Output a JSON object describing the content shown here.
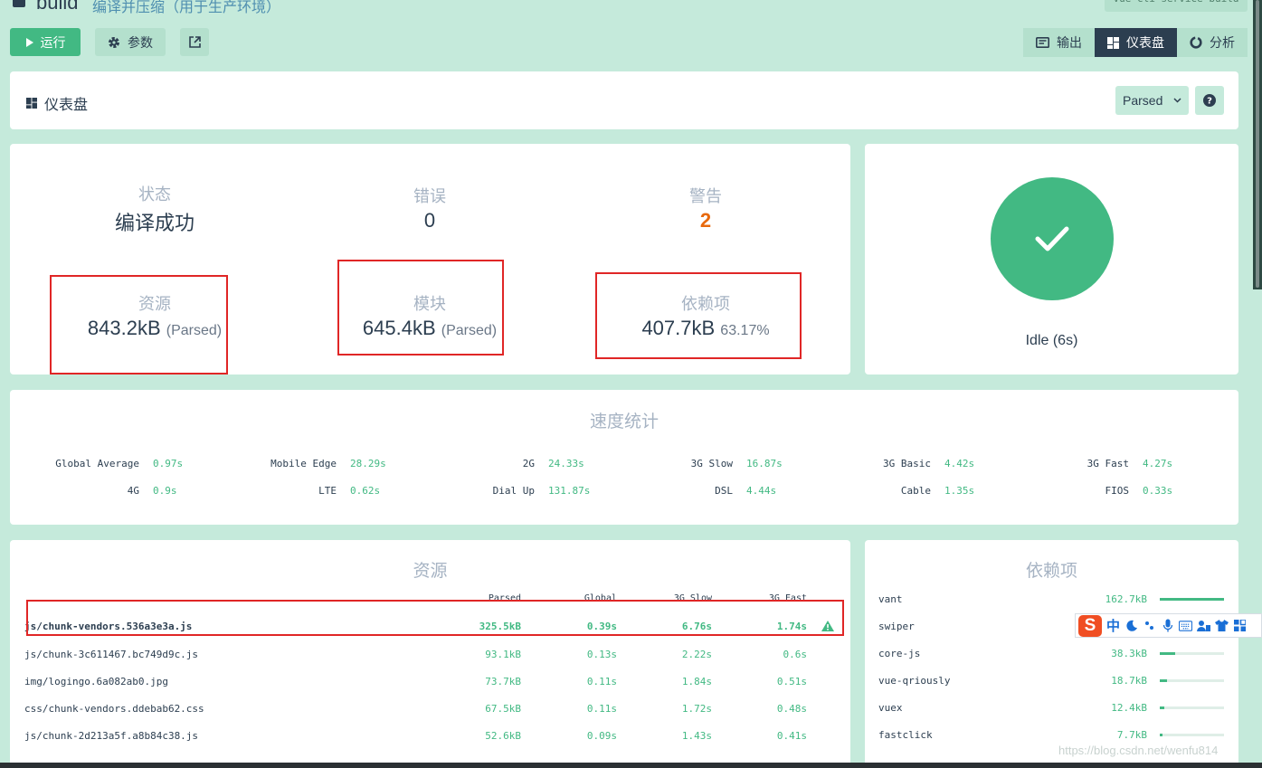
{
  "project": {
    "name": "build",
    "description": "编译并压缩（用于生产环境）",
    "command": "vue-cli-service build"
  },
  "toolbar": {
    "run_label": "运行",
    "params_label": "参数"
  },
  "view_tabs": [
    {
      "label": "输出",
      "active": false
    },
    {
      "label": "仪表盘",
      "active": true
    },
    {
      "label": "分析",
      "active": false
    }
  ],
  "dashboard": {
    "title": "仪表盘",
    "mode": "Parsed"
  },
  "stats": {
    "status": {
      "label": "状态",
      "value": "编译成功"
    },
    "errors": {
      "label": "错误",
      "value": "0"
    },
    "warnings": {
      "label": "警告",
      "value": "2"
    },
    "assets": {
      "label": "资源",
      "value": "843.2kB",
      "note": "(Parsed)"
    },
    "modules": {
      "label": "模块",
      "value": "645.4kB",
      "note": "(Parsed)"
    },
    "dependencies": {
      "label": "依赖项",
      "value": "407.7kB",
      "note": "63.17%"
    }
  },
  "build_status": {
    "text": "Idle (6s)"
  },
  "speed": {
    "title": "速度统计",
    "items": [
      {
        "label": "Global Average",
        "value": "0.97s"
      },
      {
        "label": "Mobile Edge",
        "value": "28.29s"
      },
      {
        "label": "2G",
        "value": "24.33s"
      },
      {
        "label": "3G Slow",
        "value": "16.87s"
      },
      {
        "label": "3G Basic",
        "value": "4.42s"
      },
      {
        "label": "3G Fast",
        "value": "4.27s"
      },
      {
        "label": "4G",
        "value": "0.9s"
      },
      {
        "label": "LTE",
        "value": "0.62s"
      },
      {
        "label": "Dial Up",
        "value": "131.87s"
      },
      {
        "label": "DSL",
        "value": "4.44s"
      },
      {
        "label": "Cable",
        "value": "1.35s"
      },
      {
        "label": "FIOS",
        "value": "0.33s"
      }
    ]
  },
  "assets": {
    "title": "资源",
    "columns": [
      "Parsed",
      "Global",
      "3G Slow",
      "3G Fast"
    ],
    "rows": [
      {
        "name": "js/chunk-vendors.536a3e3a.js",
        "parsed": "325.5kB",
        "global": "0.39s",
        "slow": "6.76s",
        "fast": "1.74s",
        "warning": true
      },
      {
        "name": "js/chunk-3c611467.bc749d9c.js",
        "parsed": "93.1kB",
        "global": "0.13s",
        "slow": "2.22s",
        "fast": "0.6s",
        "warning": false
      },
      {
        "name": "img/logingo.6a082ab0.jpg",
        "parsed": "73.7kB",
        "global": "0.11s",
        "slow": "1.84s",
        "fast": "0.51s",
        "warning": false
      },
      {
        "name": "css/chunk-vendors.ddebab62.css",
        "parsed": "67.5kB",
        "global": "0.11s",
        "slow": "1.72s",
        "fast": "0.48s",
        "warning": false
      },
      {
        "name": "js/chunk-2d213a5f.a8b84c38.js",
        "parsed": "52.6kB",
        "global": "0.09s",
        "slow": "1.43s",
        "fast": "0.41s",
        "warning": false
      }
    ]
  },
  "dependencies": {
    "title": "依赖项",
    "rows": [
      {
        "name": "vant",
        "size": "162.7kB",
        "ratio": 1.0
      },
      {
        "name": "swiper",
        "size": "",
        "ratio": 0.0
      },
      {
        "name": "core-js",
        "size": "38.3kB",
        "ratio": 0.235
      },
      {
        "name": "vue-qriously",
        "size": "18.7kB",
        "ratio": 0.115
      },
      {
        "name": "vuex",
        "size": "12.4kB",
        "ratio": 0.076
      },
      {
        "name": "fastclick",
        "size": "7.7kB",
        "ratio": 0.047
      }
    ]
  },
  "ime": {
    "logo": "S",
    "mode": "中"
  },
  "watermark": "https://blog.csdn.net/wenfu814",
  "colors": {
    "accent": "#42b983",
    "warning": "#e8690d",
    "dark": "#2c3e50",
    "highlight_box": "#e02626"
  }
}
